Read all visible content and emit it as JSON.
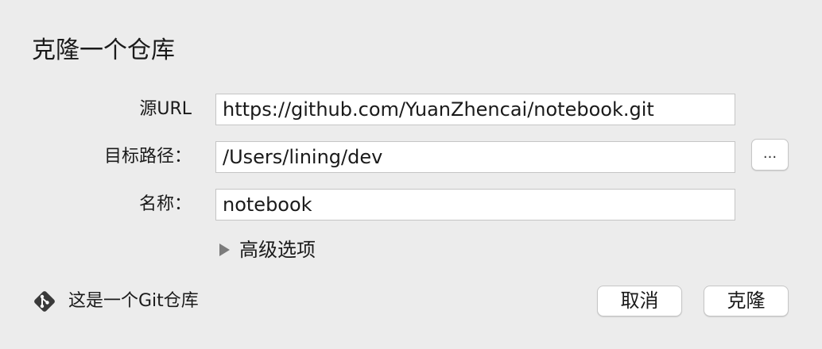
{
  "dialog": {
    "title": "克隆一个仓库"
  },
  "form": {
    "source_url": {
      "label": "源URL",
      "value": "https://github.com/YuanZhencai/notebook.git"
    },
    "target_path": {
      "label": "目标路径：",
      "value": "/Users/lining/dev",
      "browse_label": "..."
    },
    "name": {
      "label": "名称：",
      "value": "notebook"
    },
    "advanced": {
      "label": "高级选项",
      "expanded": false
    }
  },
  "footer": {
    "repo_status": {
      "icon": "git-icon",
      "text": "这是一个Git仓库"
    },
    "cancel_label": "取消",
    "clone_label": "克隆"
  },
  "colors": {
    "background": "#ececec",
    "git_icon": "#3a3a3a",
    "disclosure_triangle": "#7c7c7c"
  }
}
